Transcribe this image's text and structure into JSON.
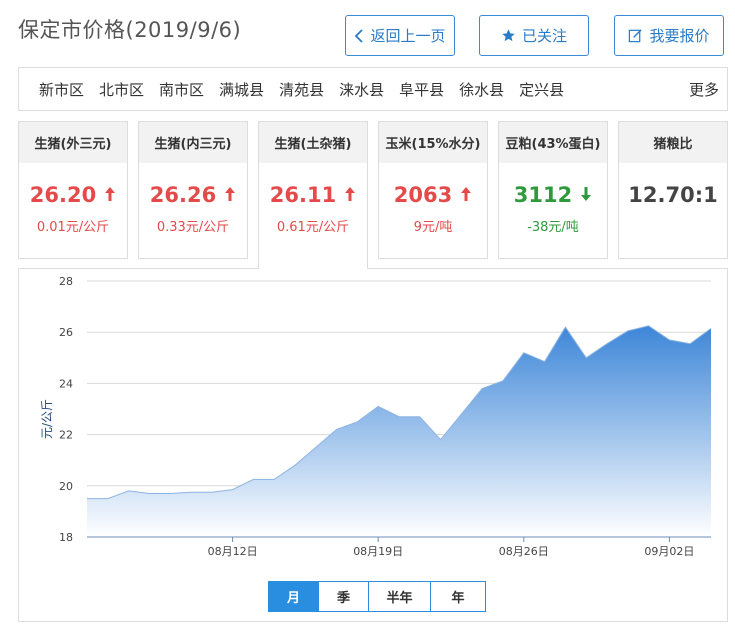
{
  "header": {
    "title": "保定市价格(2019/9/6)",
    "back_label": "返回上一页",
    "follow_label": "已关注",
    "quote_label": "我要报价"
  },
  "regions": {
    "items": [
      "新市区",
      "北市区",
      "南市区",
      "满城县",
      "清苑县",
      "涞水县",
      "阜平县",
      "徐水县",
      "定兴县"
    ],
    "more_label": "更多"
  },
  "cards": [
    {
      "title": "生猪(外三元)",
      "value": "26.20",
      "change": "0.01元/公斤",
      "trend": "up"
    },
    {
      "title": "生猪(内三元)",
      "value": "26.26",
      "change": "0.33元/公斤",
      "trend": "up"
    },
    {
      "title": "生猪(土杂猪)",
      "value": "26.11",
      "change": "0.61元/公斤",
      "trend": "up"
    },
    {
      "title": "玉米(15%水分)",
      "value": "2063",
      "change": "9元/吨",
      "trend": "up"
    },
    {
      "title": "豆粕(43%蛋白)",
      "value": "3112",
      "change": "-38元/吨",
      "trend": "down"
    },
    {
      "title": "猪粮比",
      "value": "12.70:1",
      "change": "",
      "trend": "none"
    }
  ],
  "colors": {
    "up": "#e44a4a",
    "down": "#2f9a3c",
    "accent": "#2a8ee0",
    "area_top": "#3d86d8",
    "area_bottom": "#ffffff"
  },
  "chart_data": {
    "type": "area",
    "ylabel": "元/公斤",
    "ylim": [
      18,
      28
    ],
    "yticks": [
      18,
      20,
      22,
      24,
      26,
      28
    ],
    "xtick_labels": [
      "08月12日",
      "08月19日",
      "08月26日",
      "09月02日"
    ],
    "xtick_indices": [
      7,
      14,
      21,
      28
    ],
    "x": [
      "08-07",
      "08-08",
      "08-09",
      "08-10",
      "08-11",
      "08-12",
      "08-13",
      "08-14",
      "08-15",
      "08-16",
      "08-17",
      "08-18",
      "08-19",
      "08-20",
      "08-21",
      "08-22",
      "08-23",
      "08-24",
      "08-25",
      "08-26",
      "08-27",
      "08-28",
      "08-29",
      "08-30",
      "08-31",
      "09-01",
      "09-02",
      "09-03",
      "09-04",
      "09-05",
      "09-06"
    ],
    "values": [
      19.5,
      19.5,
      19.8,
      19.7,
      19.7,
      19.75,
      19.75,
      19.85,
      20.25,
      20.25,
      20.8,
      21.5,
      22.2,
      22.5,
      23.1,
      22.7,
      22.7,
      21.8,
      22.8,
      23.8,
      24.1,
      25.2,
      24.85,
      26.2,
      25.0,
      25.55,
      26.05,
      26.25,
      25.7,
      25.55,
      26.15
    ],
    "grid": true
  },
  "period_tabs": {
    "items": [
      "月",
      "季",
      "半年",
      "年"
    ],
    "active": "月"
  }
}
